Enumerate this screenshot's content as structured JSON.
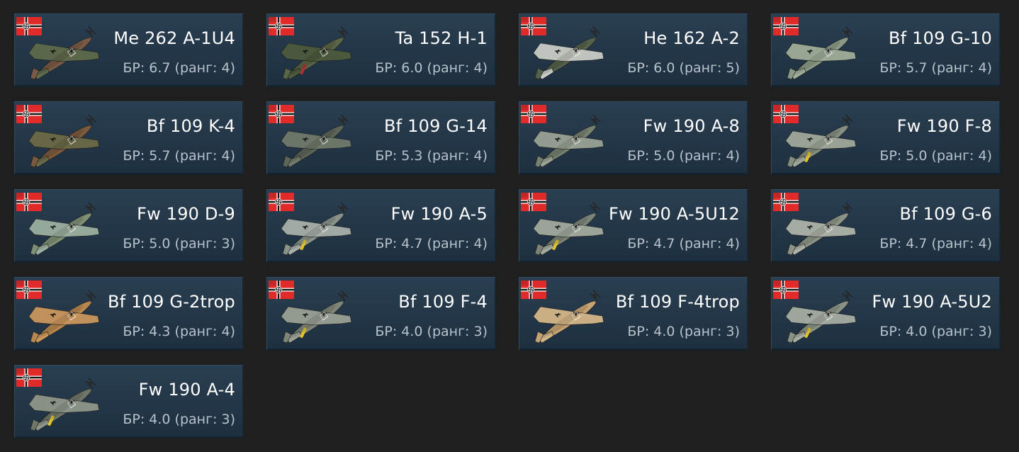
{
  "colors": {
    "background": "#1f1f1f",
    "card": "#253a4d",
    "name_text": "#ffffff",
    "br_text": "#b9c2ca",
    "flag_red": "#e12a2a"
  },
  "flag_icon": "germany-war-ensign-icon",
  "vehicles": [
    {
      "name": "Me 262 A-1U4",
      "br": "БР: 6.7 (ранг: 4)",
      "body": "#7a5a46",
      "wing": "#5e6a4c",
      "accent": ""
    },
    {
      "name": "Ta 152 H-1",
      "br": "БР: 6.0 (ранг: 4)",
      "body": "#5a6446",
      "wing": "#4d5a3d",
      "accent": "#a33"
    },
    {
      "name": "He 162 A-2",
      "br": "БР: 6.0 (ранг: 5)",
      "body": "#54614b",
      "wing": "#c8ccc6",
      "accent": ""
    },
    {
      "name": "Bf 109 G-10",
      "br": "БР: 5.7 (ранг: 4)",
      "body": "#8b9a86",
      "wing": "#9fae98",
      "accent": ""
    },
    {
      "name": "Bf 109 K-4",
      "br": "БР: 5.7 (ранг: 4)",
      "body": "#7b5a3e",
      "wing": "#6b6a48",
      "accent": ""
    },
    {
      "name": "Bf 109 G-14",
      "br": "БР: 5.3 (ранг: 4)",
      "body": "#5c6558",
      "wing": "#707a6a",
      "accent": ""
    },
    {
      "name": "Fw 190 A-8",
      "br": "БР: 5.0 (ранг: 4)",
      "body": "#76806e",
      "wing": "#9aa294",
      "accent": ""
    },
    {
      "name": "Fw 190 F-8",
      "br": "БР: 5.0 (ранг: 4)",
      "body": "#858e80",
      "wing": "#a0a89a",
      "accent": "#e2c32b"
    },
    {
      "name": "Fw 190 D-9",
      "br": "БР: 5.0 (ранг: 3)",
      "body": "#7e8f73",
      "wing": "#9cb0a0",
      "accent": ""
    },
    {
      "name": "Fw 190 A-5",
      "br": "БР: 4.7 (ранг: 4)",
      "body": "#89938a",
      "wing": "#a8b0aa",
      "accent": "#e2c32b"
    },
    {
      "name": "Fw 190 A-5U12",
      "br": "БР: 4.7 (ранг: 4)",
      "body": "#7b8376",
      "wing": "#a3aa9e",
      "accent": "#e2c32b"
    },
    {
      "name": "Bf 109 G-6",
      "br": "БР: 4.7 (ранг: 4)",
      "body": "#8d9487",
      "wing": "#adb3a8",
      "accent": ""
    },
    {
      "name": "Bf 109 G-2trop",
      "br": "БР: 4.3 (ранг: 4)",
      "body": "#b7874f",
      "wing": "#c9965c",
      "accent": ""
    },
    {
      "name": "Bf 109 F-4",
      "br": "БР: 4.0 (ранг: 3)",
      "body": "#7f8677",
      "wing": "#9aa094",
      "accent": "#e2c32b"
    },
    {
      "name": "Bf 109 F-4trop",
      "br": "БР: 4.0 (ранг: 3)",
      "body": "#c6a374",
      "wing": "#d3b689",
      "accent": ""
    },
    {
      "name": "Fw 190 A-5U2",
      "br": "БР: 4.0 (ранг: 3)",
      "body": "#8a9285",
      "wing": "#a6ada2",
      "accent": "#e2c32b"
    },
    {
      "name": "Fw 190 A-4",
      "br": "БР: 4.0 (ранг: 3)",
      "body": "#6f7668",
      "wing": "#8f968a",
      "accent": "#e2c32b"
    }
  ]
}
